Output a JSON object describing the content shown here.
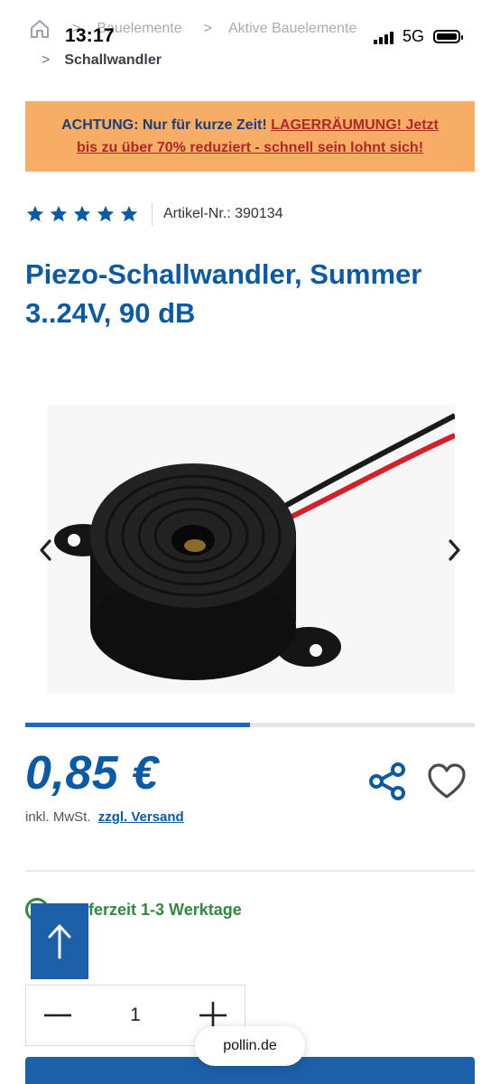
{
  "status_bar": {
    "time": "13:17",
    "network": "5G"
  },
  "breadcrumb": {
    "items": [
      "Bauelemente",
      "Aktive Bauelemente"
    ],
    "current": "Schallwandler",
    "separator": ">"
  },
  "promo": {
    "line1_prefix": "ACHTUNG: Nur für kurze Zeit! ",
    "line1_link": "LAGERRÄUMUNG! Jetzt",
    "line2": "bis zu über 70% reduziert - schnell sein lohnt sich!"
  },
  "product": {
    "rating_stars": 5,
    "article_number": "Artikel-Nr.: 390134",
    "title": "Piezo-Schallwandler, Summer 3..24V, 90 dB",
    "price": "0,85 €",
    "vat_text": "inkl. MwSt.",
    "shipping_link": "zzgl. Versand",
    "delivery": "Lieferzeit 1-3 Werktage",
    "delivery_visible": "ferzeit 1-3 Werktage"
  },
  "carousel": {
    "progress_fraction": 0.5
  },
  "quantity": {
    "value": "1",
    "minus_symbol": "−",
    "plus_symbol": "+"
  },
  "browser": {
    "url": "pollin.de"
  },
  "colors": {
    "brand_blue": "#0b5aa6",
    "promo_bg": "#f8ad66",
    "success_green": "#2e8b3e",
    "button_blue": "#1d5fa8"
  },
  "icons": [
    "home-icon",
    "star-icon",
    "chevron-left-icon",
    "chevron-right-icon",
    "share-icon",
    "heart-icon",
    "check-circle-icon",
    "arrow-up-icon",
    "minus-icon",
    "plus-icon",
    "battery-icon",
    "signal-icon"
  ]
}
